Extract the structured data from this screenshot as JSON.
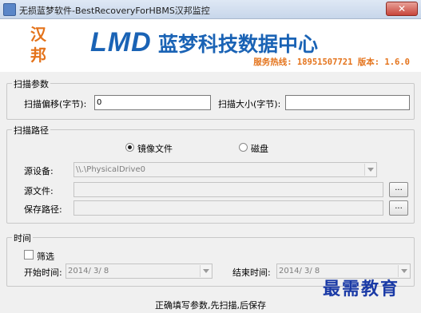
{
  "window": {
    "title": "无损蓝梦软件-BestRecoveryForHBMS汉邦监控",
    "close_label": "✕"
  },
  "header": {
    "logo_chars": [
      "汉",
      "邦"
    ],
    "brand_logo": "LMD",
    "brand_title": "蓝梦科技数据中心",
    "hotline": "服务热线: 18951507721 版本: 1.6.0"
  },
  "scan_params": {
    "legend": "扫描参数",
    "offset_label": "扫描偏移(字节):",
    "offset_value": "0",
    "size_label": "扫描大小(字节):",
    "size_value": ""
  },
  "scan_path": {
    "legend": "扫描路径",
    "radio_image_label": "镜像文件",
    "radio_disk_label": "磁盘",
    "source_device_label": "源设备:",
    "source_device_value": "\\\\.\\PhysicalDrive0",
    "source_file_label": "源文件:",
    "source_file_value": "",
    "save_path_label": "保存路径:",
    "save_path_value": "",
    "browse_label": "..."
  },
  "time": {
    "legend": "时间",
    "filter_label": "筛选",
    "start_label": "开始时间:",
    "start_value": "2014/ 3/ 8",
    "end_label": "结束时间:",
    "end_value": "2014/ 3/ 8"
  },
  "status_text": "正确填写参数,先扫描,后保存",
  "watermark": "最需教育"
}
